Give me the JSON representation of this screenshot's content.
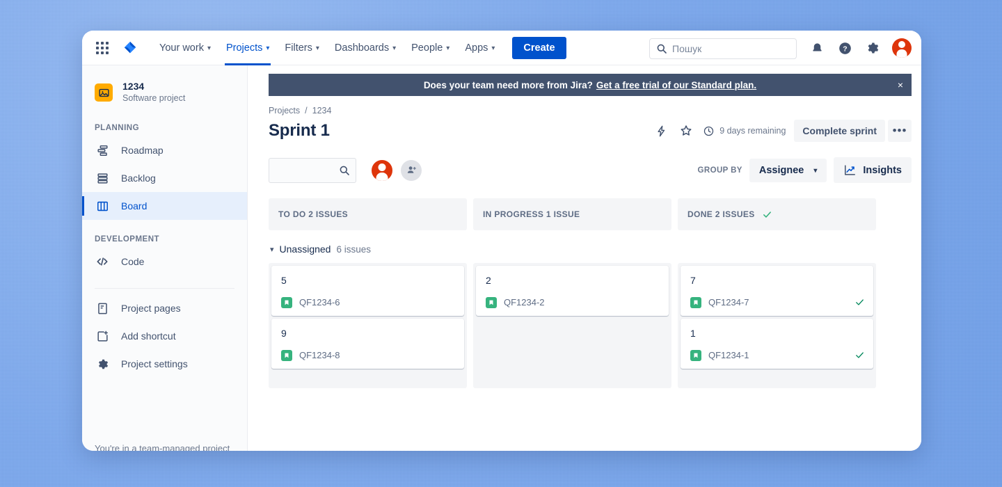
{
  "topnav": {
    "app_switcher": "app-switcher",
    "logo": "jira-logo",
    "items": [
      {
        "label": "Your work",
        "has_caret": true,
        "active": false
      },
      {
        "label": "Projects",
        "has_caret": true,
        "active": true
      },
      {
        "label": "Filters",
        "has_caret": true,
        "active": false
      },
      {
        "label": "Dashboards",
        "has_caret": true,
        "active": false
      },
      {
        "label": "People",
        "has_caret": true,
        "active": false
      },
      {
        "label": "Apps",
        "has_caret": true,
        "active": false
      }
    ],
    "create_label": "Create",
    "search_placeholder": "Пошук",
    "search_value": ""
  },
  "banner": {
    "text": "Does your team need more from Jira?",
    "link": "Get a free trial of our Standard plan.",
    "close": "×"
  },
  "sidebar": {
    "project_name": "1234",
    "project_type": "Software project",
    "planning_label": "PLANNING",
    "planning_items": [
      {
        "label": "Roadmap",
        "selected": false
      },
      {
        "label": "Backlog",
        "selected": false
      },
      {
        "label": "Board",
        "selected": true
      }
    ],
    "development_label": "DEVELOPMENT",
    "development_items": [
      {
        "label": "Code",
        "selected": false
      }
    ],
    "footer_items": [
      {
        "label": "Project pages",
        "selected": false
      },
      {
        "label": "Add shortcut",
        "selected": false
      },
      {
        "label": "Project settings",
        "selected": false
      }
    ],
    "bottom_note": "You're in a team-managed project"
  },
  "header": {
    "breadcrumb_root": "Projects",
    "breadcrumb_sep": "/",
    "breadcrumb_project": "1234",
    "title": "Sprint 1",
    "days_remaining": "9 days remaining",
    "complete_sprint": "Complete sprint",
    "more_actions": "•••"
  },
  "toolbar": {
    "search_value": "",
    "search_placeholder": "",
    "group_by_label": "GROUP BY",
    "group_by_value": "Assignee",
    "insights_label": "Insights"
  },
  "board": {
    "group": {
      "name": "Unassigned",
      "count": "6 issues"
    },
    "columns": [
      {
        "header": "TO DO 2 ISSUES",
        "done_check": false,
        "cards": [
          {
            "title": "5",
            "key": "QF1234-6",
            "type": "story",
            "done": false
          },
          {
            "title": "9",
            "key": "QF1234-8",
            "type": "story",
            "done": false
          }
        ]
      },
      {
        "header": "IN PROGRESS 1 ISSUE",
        "done_check": false,
        "cards": [
          {
            "title": "2",
            "key": "QF1234-2",
            "type": "story",
            "done": false
          }
        ]
      },
      {
        "header": "DONE 2 ISSUES",
        "done_check": true,
        "cards": [
          {
            "title": "7",
            "key": "QF1234-7",
            "type": "story",
            "done": true
          },
          {
            "title": "1",
            "key": "QF1234-1",
            "type": "story",
            "done": true
          }
        ]
      }
    ]
  },
  "colors": {
    "brand_blue": "#0052cc",
    "banner_bg": "#42526e",
    "story_green": "#36b37e",
    "done_green": "#00875a",
    "avatar_red": "#de350b",
    "project_avatar": "#ffab00",
    "selected_nav_bg": "#e6effc",
    "column_bg": "#f4f5f7",
    "purple_widget": "#6554c0"
  }
}
